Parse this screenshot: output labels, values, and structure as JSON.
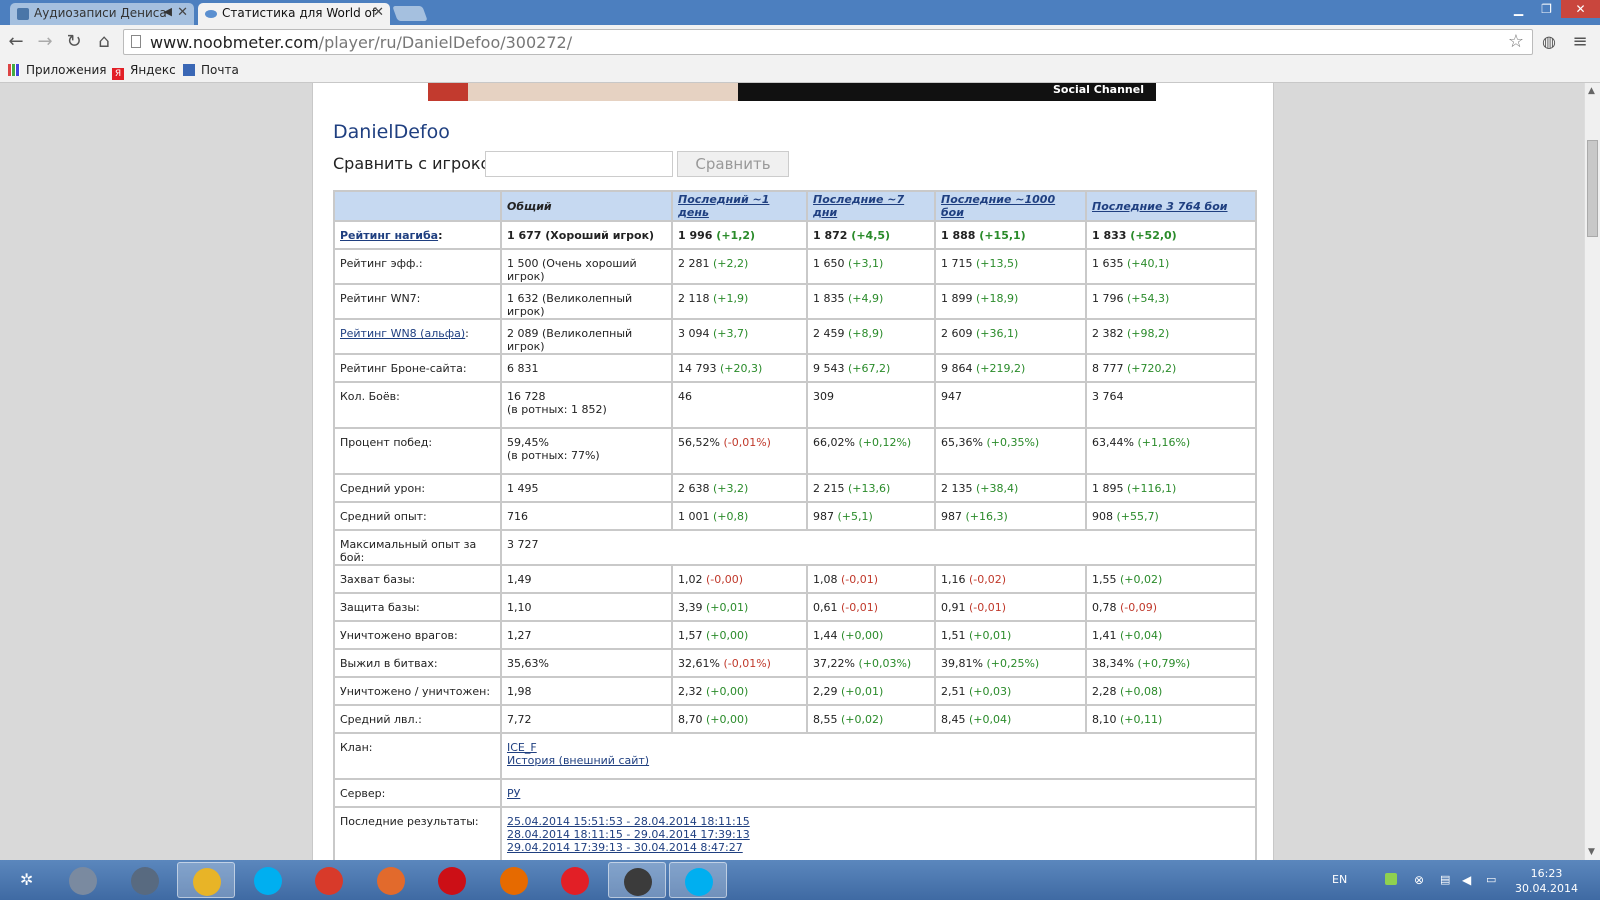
{
  "browser": {
    "tabs": [
      {
        "title": "Аудиозаписи Дениса",
        "active": false
      },
      {
        "title": "Статистика для World of",
        "active": true
      }
    ],
    "address": {
      "host": "www.noobmeter.com",
      "path": "/player/ru/DanielDefoo/300272/"
    },
    "bookmarks": [
      "Приложения",
      "Яндекс",
      "Почта"
    ]
  },
  "banner": {
    "text": "Social Channel"
  },
  "player": {
    "name": "DanielDefoo",
    "compare_label": "Сравнить с игроком",
    "compare_button": "Сравнить"
  },
  "table": {
    "headers": [
      "",
      "Общий",
      "Последний ~1 день",
      "Последние ~7 дни",
      "Последние ~1000 бои",
      "Последние 3 764 бои"
    ],
    "rows": [
      {
        "label": "Рейтинг нагиба",
        "label_link": true,
        "bold": true,
        "cells": [
          [
            "1 677 (Хороший игрок)",
            ""
          ],
          [
            "1 996",
            "(+1,2)"
          ],
          [
            "1 872",
            "(+4,5)"
          ],
          [
            "1 888",
            "(+15,1)"
          ],
          [
            "1 833",
            "(+52,0)"
          ]
        ]
      },
      {
        "label": "Рейтинг эфф.:",
        "cells": [
          [
            "1 500 (Очень хороший игрок)",
            ""
          ],
          [
            "2 281",
            "(+2,2)"
          ],
          [
            "1 650",
            "(+3,1)"
          ],
          [
            "1 715",
            "(+13,5)"
          ],
          [
            "1 635",
            "(+40,1)"
          ]
        ]
      },
      {
        "label": "Рейтинг WN7:",
        "cells": [
          [
            "1 632 (Великолепный игрок)",
            ""
          ],
          [
            "2 118",
            "(+1,9)"
          ],
          [
            "1 835",
            "(+4,9)"
          ],
          [
            "1 899",
            "(+18,9)"
          ],
          [
            "1 796",
            "(+54,3)"
          ]
        ]
      },
      {
        "label": "Рейтинг WN8 (альфа)",
        "label_link": true,
        "cells": [
          [
            "2 089 (Великолепный игрок)",
            ""
          ],
          [
            "3 094",
            "(+3,7)"
          ],
          [
            "2 459",
            "(+8,9)"
          ],
          [
            "2 609",
            "(+36,1)"
          ],
          [
            "2 382",
            "(+98,2)"
          ]
        ]
      },
      {
        "label": "Рейтинг Броне-сайта:",
        "cells": [
          [
            "6 831",
            ""
          ],
          [
            "14 793",
            "(+20,3)"
          ],
          [
            "9 543",
            "(+67,2)"
          ],
          [
            "9 864",
            "(+219,2)"
          ],
          [
            "8 777",
            "(+720,2)"
          ]
        ]
      },
      {
        "label": "Кол. Боёв:",
        "tall": true,
        "cells": [
          [
            "16 728",
            "",
            "(в ротных: 1 852)"
          ],
          [
            "46",
            ""
          ],
          [
            "309",
            ""
          ],
          [
            "947",
            ""
          ],
          [
            "3 764",
            ""
          ]
        ]
      },
      {
        "label": "Процент побед:",
        "tall": true,
        "cells": [
          [
            "59,45%",
            "",
            "(в ротных: 77%)"
          ],
          [
            "56,52%",
            "(-0,01%)"
          ],
          [
            "66,02%",
            "(+0,12%)"
          ],
          [
            "65,36%",
            "(+0,35%)"
          ],
          [
            "63,44%",
            "(+1,16%)"
          ]
        ]
      },
      {
        "label": "Средний урон:",
        "cells": [
          [
            "1 495",
            ""
          ],
          [
            "2 638",
            "(+3,2)"
          ],
          [
            "2 215",
            "(+13,6)"
          ],
          [
            "2 135",
            "(+38,4)"
          ],
          [
            "1 895",
            "(+116,1)"
          ]
        ]
      },
      {
        "label": "Средний опыт:",
        "cells": [
          [
            "716",
            ""
          ],
          [
            "1 001",
            "(+0,8)"
          ],
          [
            "987",
            "(+5,1)"
          ],
          [
            "987",
            "(+16,3)"
          ],
          [
            "908",
            "(+55,7)"
          ]
        ]
      },
      {
        "label": "Максимальный опыт за бой:",
        "span": true,
        "value": "3 727"
      },
      {
        "label": "Захват базы:",
        "cells": [
          [
            "1,49",
            ""
          ],
          [
            "1,02",
            "(-0,00)"
          ],
          [
            "1,08",
            "(-0,01)"
          ],
          [
            "1,16",
            "(-0,02)"
          ],
          [
            "1,55",
            "(+0,02)"
          ]
        ]
      },
      {
        "label": "Защита базы:",
        "cells": [
          [
            "1,10",
            ""
          ],
          [
            "3,39",
            "(+0,01)"
          ],
          [
            "0,61",
            "(-0,01)"
          ],
          [
            "0,91",
            "(-0,01)"
          ],
          [
            "0,78",
            "(-0,09)"
          ]
        ]
      },
      {
        "label": "Уничтожено врагов:",
        "cells": [
          [
            "1,27",
            ""
          ],
          [
            "1,57",
            "(+0,00)"
          ],
          [
            "1,44",
            "(+0,00)"
          ],
          [
            "1,51",
            "(+0,01)"
          ],
          [
            "1,41",
            "(+0,04)"
          ]
        ]
      },
      {
        "label": "Выжил в битвах:",
        "cells": [
          [
            "35,63%",
            ""
          ],
          [
            "32,61%",
            "(-0,01%)"
          ],
          [
            "37,22%",
            "(+0,03%)"
          ],
          [
            "39,81%",
            "(+0,25%)"
          ],
          [
            "38,34%",
            "(+0,79%)"
          ]
        ]
      },
      {
        "label": "Уничтожено / уничтожен:",
        "cells": [
          [
            "1,98",
            ""
          ],
          [
            "2,32",
            "(+0,00)"
          ],
          [
            "2,29",
            "(+0,01)"
          ],
          [
            "2,51",
            "(+0,03)"
          ],
          [
            "2,28",
            "(+0,08)"
          ]
        ]
      },
      {
        "label": "Средний лвл.:",
        "cells": [
          [
            "7,72",
            ""
          ],
          [
            "8,70",
            "(+0,00)"
          ],
          [
            "8,55",
            "(+0,02)"
          ],
          [
            "8,45",
            "(+0,04)"
          ],
          [
            "8,10",
            "(+0,11)"
          ]
        ]
      },
      {
        "label": "Клан:",
        "span": true,
        "tall": true,
        "links": [
          "ICE_F",
          "История (внешний сайт)"
        ]
      },
      {
        "label": "Сервер:",
        "span": true,
        "links": [
          "РУ"
        ]
      },
      {
        "label": "Последние результаты:",
        "span": true,
        "results": true,
        "links": [
          "25.04.2014 15:51:53 - 28.04.2014 18:11:15",
          "28.04.2014 18:11:15 - 29.04.2014 17:39:13",
          "29.04.2014 17:39:13 - 30.04.2014 8:47:27"
        ]
      }
    ]
  },
  "taskbar": {
    "apps": [
      {
        "name": "file-manager",
        "color": "#7a8aa0"
      },
      {
        "name": "audio",
        "color": "#586a80"
      },
      {
        "name": "chrome",
        "color": "#e8b427",
        "active": true
      },
      {
        "name": "skype",
        "color": "#00aff0"
      },
      {
        "name": "opera-red",
        "color": "#d83a2a"
      },
      {
        "name": "app-orange",
        "color": "#e26a2c"
      },
      {
        "name": "opera",
        "color": "#cc0f16"
      },
      {
        "name": "firefox",
        "color": "#e66a00"
      },
      {
        "name": "yandex",
        "color": "#e21f26"
      },
      {
        "name": "world-of-tanks",
        "color": "#3b3b3b",
        "active": true
      },
      {
        "name": "skype-2",
        "color": "#00aff0",
        "active": true
      }
    ],
    "lang": "EN",
    "time": "16:23",
    "date": "30.04.2014"
  },
  "colors": {
    "positive": "#2a8b2a",
    "negative": "#c0392b",
    "header_bg": "#c6d9f1",
    "link": "#1f3f80"
  }
}
